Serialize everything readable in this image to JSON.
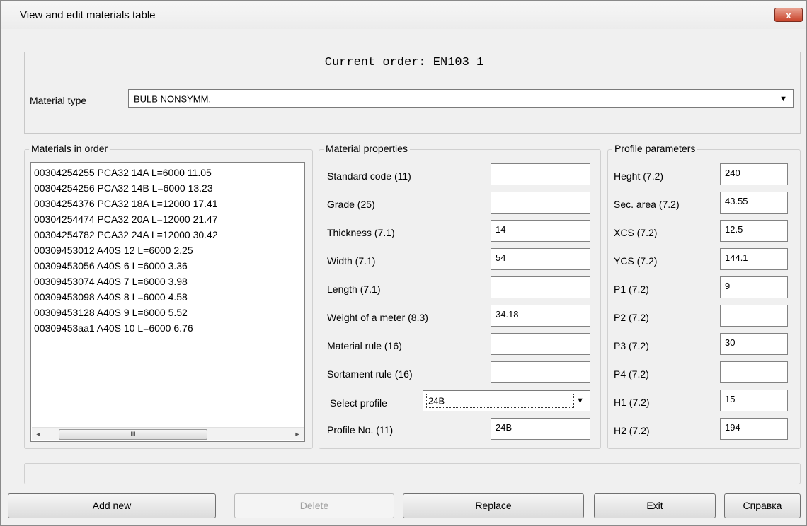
{
  "window": {
    "title": "View and edit materials table",
    "close_label": "x"
  },
  "header": {
    "current_order": "Current order: EN103_1",
    "material_type_label": "Material type",
    "material_type_value": "BULB NONSYMM."
  },
  "materials": {
    "legend": "Materials in order",
    "items": [
      "00304254255 PCA32 14A L=6000 11.05",
      "00304254256 PCA32 14B L=6000 13.23",
      "00304254376 PCA32 18A L=12000 17.41",
      "00304254474 PCA32 20A L=12000 21.47",
      "00304254782 PCA32 24A L=12000 30.42",
      "00309453012 A40S 12 L=6000 2.25",
      "00309453056 A40S 6 L=6000 3.36",
      "00309453074 A40S 7 L=6000 3.98",
      "00309453098 A40S 8 L=6000 4.58",
      "00309453128 A40S 9 L=6000 5.52",
      "00309453aa1 A40S 10 L=6000 6.76"
    ],
    "scroll_left": "◄",
    "scroll_right": "►",
    "thumb_grip": "III"
  },
  "properties": {
    "legend": "Material properties",
    "rows": [
      {
        "label": "Standard code (11)",
        "value": ""
      },
      {
        "label": "Grade (25)",
        "value": ""
      },
      {
        "label": "Thickness (7.1)",
        "value": "14"
      },
      {
        "label": "Width (7.1)",
        "value": "54"
      },
      {
        "label": "Length (7.1)",
        "value": ""
      },
      {
        "label": "Weight of a meter (8.3)",
        "value": "34.18"
      },
      {
        "label": "Material rule (16)",
        "value": ""
      },
      {
        "label": "Sortament rule (16)",
        "value": ""
      }
    ],
    "select_profile_label": "Select profile",
    "select_profile_value": "24B",
    "profile_no_label": "Profile No. (11)",
    "profile_no_value": "24B"
  },
  "profile": {
    "legend": "Profile parameters",
    "rows": [
      {
        "label": "Heght (7.2)",
        "value": "240"
      },
      {
        "label": "Sec. area (7.2)",
        "value": "43.55"
      },
      {
        "label": "XCS (7.2)",
        "value": "12.5"
      },
      {
        "label": "YCS (7.2)",
        "value": "144.1"
      },
      {
        "label": "P1 (7.2)",
        "value": "9"
      },
      {
        "label": "P2 (7.2)",
        "value": ""
      },
      {
        "label": "P3 (7.2)",
        "value": "30"
      },
      {
        "label": "P4 (7.2)",
        "value": ""
      },
      {
        "label": "H1 (7.2)",
        "value": "15"
      },
      {
        "label": "H2 (7.2)",
        "value": "194"
      }
    ]
  },
  "buttons": {
    "add_new": "Add new",
    "delete": "Delete",
    "replace": "Replace",
    "exit": "Exit",
    "help": "Справка"
  }
}
